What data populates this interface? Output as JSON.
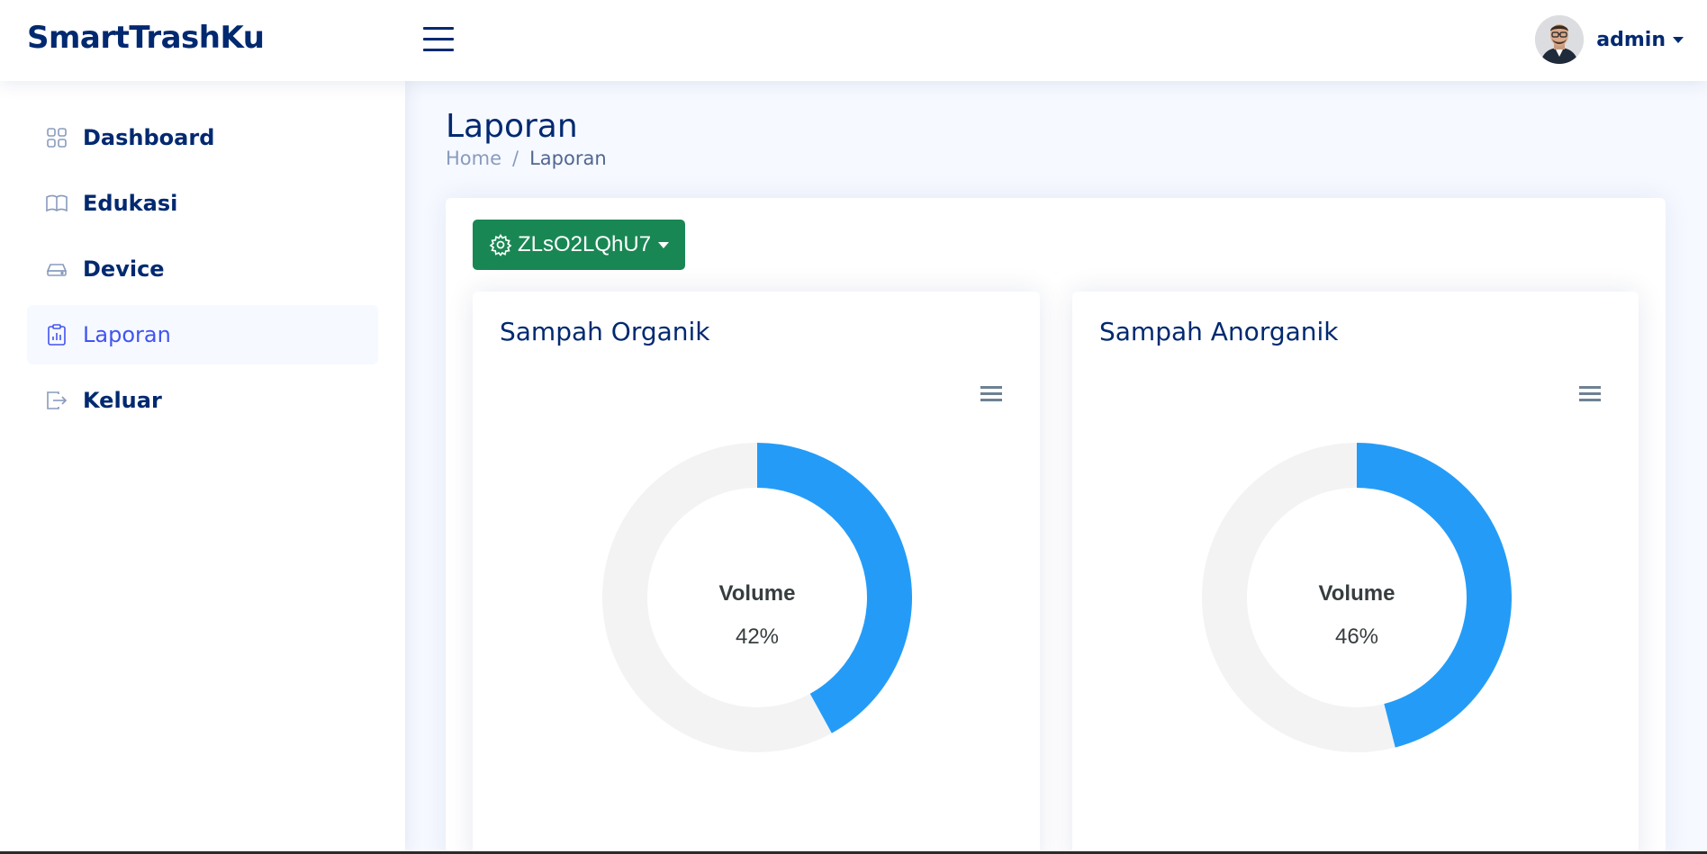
{
  "header": {
    "logo": "SmartTrashKu",
    "user_name": "admin"
  },
  "sidebar": {
    "items": [
      {
        "label": "Dashboard",
        "icon": "grid-icon",
        "active": false
      },
      {
        "label": "Edukasi",
        "icon": "book-icon",
        "active": false
      },
      {
        "label": "Device",
        "icon": "hdd-icon",
        "active": false
      },
      {
        "label": "Laporan",
        "icon": "clipboard-chart-icon",
        "active": true
      },
      {
        "label": "Keluar",
        "icon": "logout-icon",
        "active": false
      }
    ]
  },
  "page": {
    "title": "Laporan",
    "breadcrumb": {
      "home": "Home",
      "separator": "/",
      "current": "Laporan"
    }
  },
  "device_selector": {
    "label": "ZLsO2LQhU7",
    "icon": "gear-icon",
    "color": "#198754"
  },
  "colors": {
    "accent": "#4154f1",
    "primary_text": "#012970",
    "donut_fill": "#249cf7",
    "donut_track": "#f3f3f3"
  },
  "chart_data": [
    {
      "type": "pie",
      "title": "Sampah Organik",
      "center_label": "Volume",
      "value": 42,
      "value_text": "42%"
    },
    {
      "type": "pie",
      "title": "Sampah Anorganik",
      "center_label": "Volume",
      "value": 46,
      "value_text": "46%"
    }
  ]
}
